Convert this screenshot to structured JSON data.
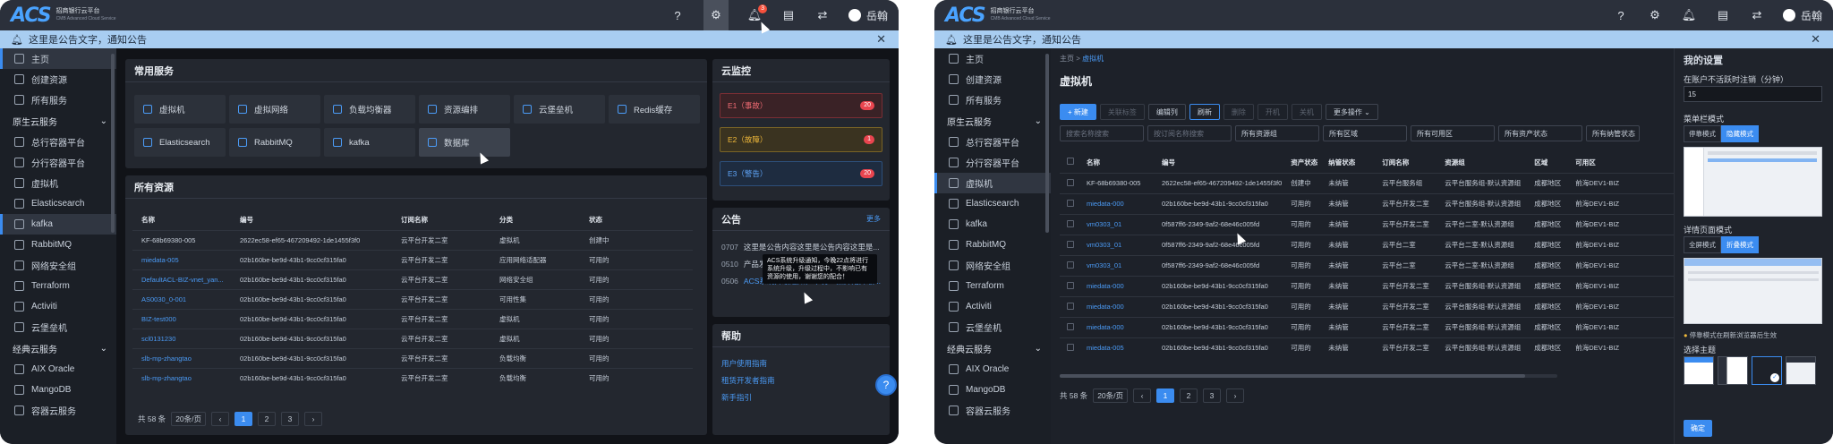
{
  "app": {
    "logo": "ACS",
    "org_cn": "招商银行云平台",
    "org_en": "CMB Advanced Cloud Service",
    "user": "岳翰",
    "notif_count": "3"
  },
  "notice": {
    "text": "这里是公告文字，通知公告",
    "icon": "bell-icon"
  },
  "sidebar": {
    "items": [
      "主页",
      "创建资源",
      "所有服务"
    ],
    "group1": "原生云服务",
    "group1_items": [
      "总行容器平台",
      "分行容器平台",
      "虚拟机",
      "Elasticsearch",
      "kafka",
      "RabbitMQ",
      "网络安全组",
      "Terraform",
      "Activiti",
      "云堡垒机"
    ],
    "group2": "经典云服务",
    "group2_items": [
      "AIX Oracle",
      "MangoDB",
      "容器云服务"
    ]
  },
  "left": {
    "common_title": "常用服务",
    "services": [
      "虚拟机",
      "虚拟网络",
      "负载均衡器",
      "资源编排",
      "云堡垒机",
      "Redis缓存",
      "Elasticsearch",
      "RabbitMQ",
      "kafka",
      "数据库"
    ],
    "all_title": "所有资源",
    "table_headers": [
      "名称",
      "编号",
      "订阅名称",
      "分类",
      "状态"
    ],
    "rows": [
      [
        "KF-68b69380-005",
        "2622ec58-ef65-467209492-1de1455f3f0",
        "云平台开发二室",
        "虚拟机",
        "创建中"
      ],
      [
        "miedata-005",
        "02b160be-be9d-43b1-9cc0cf315fa0",
        "云平台开发二室",
        "应用网络适配器",
        "可用的"
      ],
      [
        "DefaultACL-BIZ-vnet_yan...",
        "02b160be-be9d-43b1-9cc0cf315fa0",
        "云平台开发二室",
        "网络安全组",
        "可用的"
      ],
      [
        "AS0030_0-001",
        "02b160be-be9d-43b1-9cc0cf315fa0",
        "云平台开发二室",
        "可用性集",
        "可用的"
      ],
      [
        "BIZ-test000",
        "02b160be-be9d-43b1-9cc0cf315fa0",
        "云平台开发二室",
        "虚拟机",
        "可用的"
      ],
      [
        "scl0131230",
        "02b160be-be9d-43b1-9cc0cf315fa0",
        "云平台开发二室",
        "虚拟机",
        "可用的"
      ],
      [
        "slb-mp-zhangtao",
        "02b160be-be9d-43b1-9cc0cf315fa0",
        "云平台开发二室",
        "负载均衡",
        "可用的"
      ],
      [
        "slb-mp-zhangtao",
        "02b160be-be9d-43b1-9cc0cf315fa0",
        "云平台开发二室",
        "负载均衡",
        "可用的"
      ]
    ],
    "total": "共 58 条",
    "page_size": "20条/页",
    "pages": [
      "1",
      "2",
      "3"
    ],
    "monitor_title": "云监控",
    "monitor": [
      {
        "label": "E1（事故）",
        "count": "20"
      },
      {
        "label": "E2（故障）",
        "count": "1"
      },
      {
        "label": "E3（警告）",
        "count": "20"
      }
    ],
    "announce_title": "公告",
    "announce_more": "更多",
    "announce": [
      {
        "date": "0707",
        "text": "这里是公告内容这里是公告内容这里是..."
      },
      {
        "date": "0510",
        "text": "产品发布"
      },
      {
        "date": "0506",
        "text": "ACS系统升级通知，今晚22点开始升级..."
      }
    ],
    "tooltip": "ACS系统升级通知，今晚22点将进行系统升级，升级过程中，不影响已有资源的使用，谢谢您的配合！",
    "help_title": "帮助",
    "help": [
      "用户使用指南",
      "租赁开发者指南",
      "新手指引"
    ]
  },
  "right": {
    "breadcrumb": [
      "主页",
      "虚拟机"
    ],
    "title": "虚拟机",
    "toolbar": [
      "+ 新建",
      "关联标签",
      "编辑列",
      "刷新",
      "删除",
      "开机",
      "关机",
      "更多操作"
    ],
    "filters": [
      "搜索名称搜索",
      "按订阅名称搜索",
      "所有资源组",
      "所有区域",
      "所有可用区",
      "所有资产状态",
      "所有纳管状态"
    ],
    "headers": [
      "名称",
      "编号",
      "资产状态",
      "纳管状态",
      "订阅名称",
      "资源组",
      "区域",
      "可用区"
    ],
    "rows": [
      [
        "KF-68b69380-005",
        "2622ec58-ef65-467209492-1de1455f3f0",
        "创建中",
        "未纳管",
        "云平台服务组",
        "云平台服务组-默认资源组",
        "成都地区",
        "前海DEV1-BIZ"
      ],
      [
        "miedata-000",
        "02b160be-be9d-43b1-9cc0cf315fa0",
        "可用的",
        "未纳管",
        "云平台开发二室",
        "云平台服务组-默认资源组",
        "成都地区",
        "前海DEV1-BIZ"
      ],
      [
        "vm0303_01",
        "0f587ff6-2349-9af2-68e46c005fd",
        "可用的",
        "未纳管",
        "云平台开发二室",
        "云平台二室-默认资源组",
        "成都地区",
        "前海DEV1-BIZ"
      ],
      [
        "vm0303_01",
        "0f587ff6-2349-9af2-68e46c005fd",
        "可用的",
        "未纳管",
        "云平台二室",
        "云平台二室-默认资源组",
        "成都地区",
        "前海DEV1-BIZ"
      ],
      [
        "vm0303_01",
        "0f587ff6-2349-9af2-68e46c005fd",
        "可用的",
        "未纳管",
        "云平台二室",
        "云平台二室-默认资源组",
        "成都地区",
        "前海DEV1-BIZ"
      ],
      [
        "miedata-000",
        "02b160be-be9d-43b1-9cc0cf315fa0",
        "可用的",
        "未纳管",
        "云平台开发二室",
        "云平台服务组-默认资源组",
        "成都地区",
        "前海DEV1-BIZ"
      ],
      [
        "miedata-000",
        "02b160be-be9d-43b1-9cc0cf315fa0",
        "可用的",
        "未纳管",
        "云平台开发二室",
        "云平台服务组-默认资源组",
        "成都地区",
        "前海DEV1-BIZ"
      ],
      [
        "miedata-000",
        "02b160be-be9d-43b1-9cc0cf315fa0",
        "可用的",
        "未纳管",
        "云平台开发二室",
        "云平台服务组-默认资源组",
        "成都地区",
        "前海DEV1-BIZ"
      ],
      [
        "miedata-005",
        "02b160be-be9d-43b1-9cc0cf315fa0",
        "可用的",
        "未纳管",
        "云平台开发二室",
        "云平台服务组-默认资源组",
        "成都地区",
        "前海DEV1-BIZ"
      ]
    ],
    "total": "共 58 条",
    "page_size": "20条/页",
    "pages": [
      "1",
      "2",
      "3"
    ]
  },
  "settings": {
    "title": "我的设置",
    "timeout_label": "在账户不活跃时注销（分钟）",
    "timeout_value": "15",
    "menu_label": "菜单栏模式",
    "menu_opts": [
      "停靠模式",
      "隐藏模式"
    ],
    "detail_label": "详情页面模式",
    "detail_opts": [
      "全屏模式",
      "折叠模式"
    ],
    "hint": "停靠模式在刷新浏览器后生效",
    "theme_label": "选择主题",
    "ok": "确定"
  }
}
